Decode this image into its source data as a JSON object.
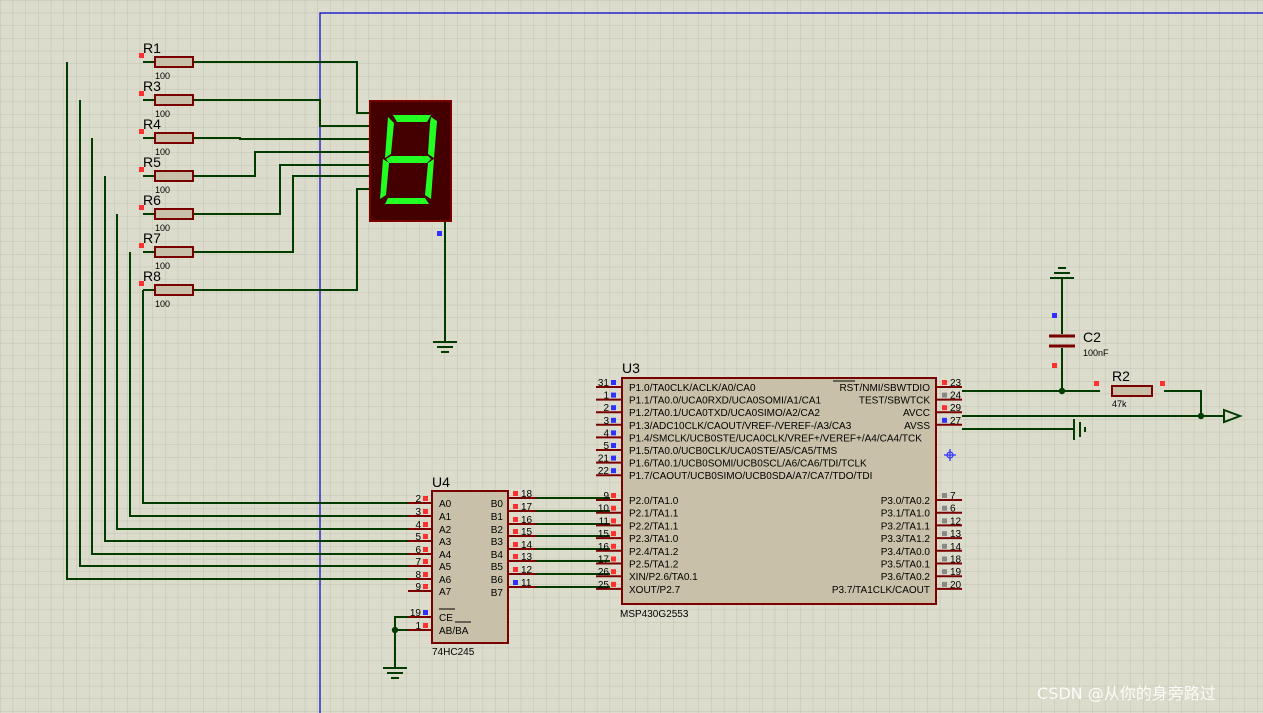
{
  "colors": {
    "background": "#dcdccc",
    "grid": "#c4c4b4",
    "wire": "#003c00",
    "border": "#0000c0",
    "component": "#7a0000",
    "body": "#c8c0a8",
    "pin_red": "#ff3030",
    "pin_blue": "#3030ff",
    "seg_on": "#22ff22",
    "seg_bg": "#440000"
  },
  "resistors": [
    {
      "ref": "R1",
      "value": "100"
    },
    {
      "ref": "R3",
      "value": "100"
    },
    {
      "ref": "R4",
      "value": "100"
    },
    {
      "ref": "R5",
      "value": "100"
    },
    {
      "ref": "R6",
      "value": "100"
    },
    {
      "ref": "R7",
      "value": "100"
    },
    {
      "ref": "R8",
      "value": "100"
    }
  ],
  "display": {
    "digit": "8"
  },
  "c2": {
    "ref": "C2",
    "value": "100nF"
  },
  "r2": {
    "ref": "R2",
    "value": "47k"
  },
  "u4": {
    "ref": "U4",
    "part": "74HC245",
    "a_pins": [
      {
        "num": "2",
        "name": "A0"
      },
      {
        "num": "3",
        "name": "A1"
      },
      {
        "num": "4",
        "name": "A2"
      },
      {
        "num": "5",
        "name": "A3"
      },
      {
        "num": "6",
        "name": "A4"
      },
      {
        "num": "7",
        "name": "A5"
      },
      {
        "num": "8",
        "name": "A6"
      },
      {
        "num": "9",
        "name": "A7"
      }
    ],
    "b_pins": [
      {
        "num": "18",
        "name": "B0"
      },
      {
        "num": "17",
        "name": "B1"
      },
      {
        "num": "16",
        "name": "B2"
      },
      {
        "num": "15",
        "name": "B3"
      },
      {
        "num": "14",
        "name": "B4"
      },
      {
        "num": "13",
        "name": "B5"
      },
      {
        "num": "12",
        "name": "B6"
      },
      {
        "num": "11",
        "name": "B7"
      }
    ],
    "ctrl_pins": [
      {
        "num": "19",
        "name": "CE"
      },
      {
        "num": "1",
        "name": "AB/BA"
      }
    ]
  },
  "u3": {
    "ref": "U3",
    "part": "MSP430G2553",
    "left_top": [
      {
        "num": "31",
        "name": "P1.0/TA0CLK/ACLK/A0/CA0"
      },
      {
        "num": "1",
        "name": "P1.1/TA0.0/UCA0RXD/UCA0SOMI/A1/CA1"
      },
      {
        "num": "2",
        "name": "P1.2/TA0.1/UCA0TXD/UCA0SIMO/A2/CA2"
      },
      {
        "num": "3",
        "name": "P1.3/ADC10CLK/CAOUT/VREF-/VEREF-/A3/CA3"
      },
      {
        "num": "4",
        "name": "P1.4/SMCLK/UCB0STE/UCA0CLK/VREF+/VEREF+/A4/CA4/TCK"
      },
      {
        "num": "5",
        "name": "P1.5/TA0.0/UCB0CLK/UCA0STE/A5/CA5/TMS"
      },
      {
        "num": "21",
        "name": "P1.6/TA0.1/UCB0SOMI/UCB0SCL/A6/CA6/TDI/TCLK"
      },
      {
        "num": "22",
        "name": "P1.7/CAOUT/UCB0SIMO/UCB0SDA/A7/CA7/TDO/TDI"
      }
    ],
    "left_bottom": [
      {
        "num": "9",
        "name": "P2.0/TA1.0"
      },
      {
        "num": "10",
        "name": "P2.1/TA1.1"
      },
      {
        "num": "11",
        "name": "P2.2/TA1.1"
      },
      {
        "num": "15",
        "name": "P2.3/TA1.0"
      },
      {
        "num": "16",
        "name": "P2.4/TA1.2"
      },
      {
        "num": "17",
        "name": "P2.5/TA1.2"
      },
      {
        "num": "26",
        "name": "XIN/P2.6/TA0.1"
      },
      {
        "num": "25",
        "name": "XOUT/P2.7"
      }
    ],
    "right_top": [
      {
        "num": "23",
        "name": "RST/NMI/SBWTDIO"
      },
      {
        "num": "24",
        "name": "TEST/SBWTCK"
      },
      {
        "num": "29",
        "name": "AVCC"
      },
      {
        "num": "27",
        "name": "AVSS"
      }
    ],
    "right_bottom": [
      {
        "num": "7",
        "name": "P3.0/TA0.2"
      },
      {
        "num": "6",
        "name": "P3.1/TA1.0"
      },
      {
        "num": "12",
        "name": "P3.2/TA1.1"
      },
      {
        "num": "13",
        "name": "P3.3/TA1.2"
      },
      {
        "num": "14",
        "name": "P3.4/TA0.0"
      },
      {
        "num": "18",
        "name": "P3.5/TA0.1"
      },
      {
        "num": "19",
        "name": "P3.6/TA0.2"
      },
      {
        "num": "20",
        "name": "P3.7/TA1CLK/CAOUT"
      }
    ]
  },
  "watermark": "CSDN @从你的身旁路过"
}
